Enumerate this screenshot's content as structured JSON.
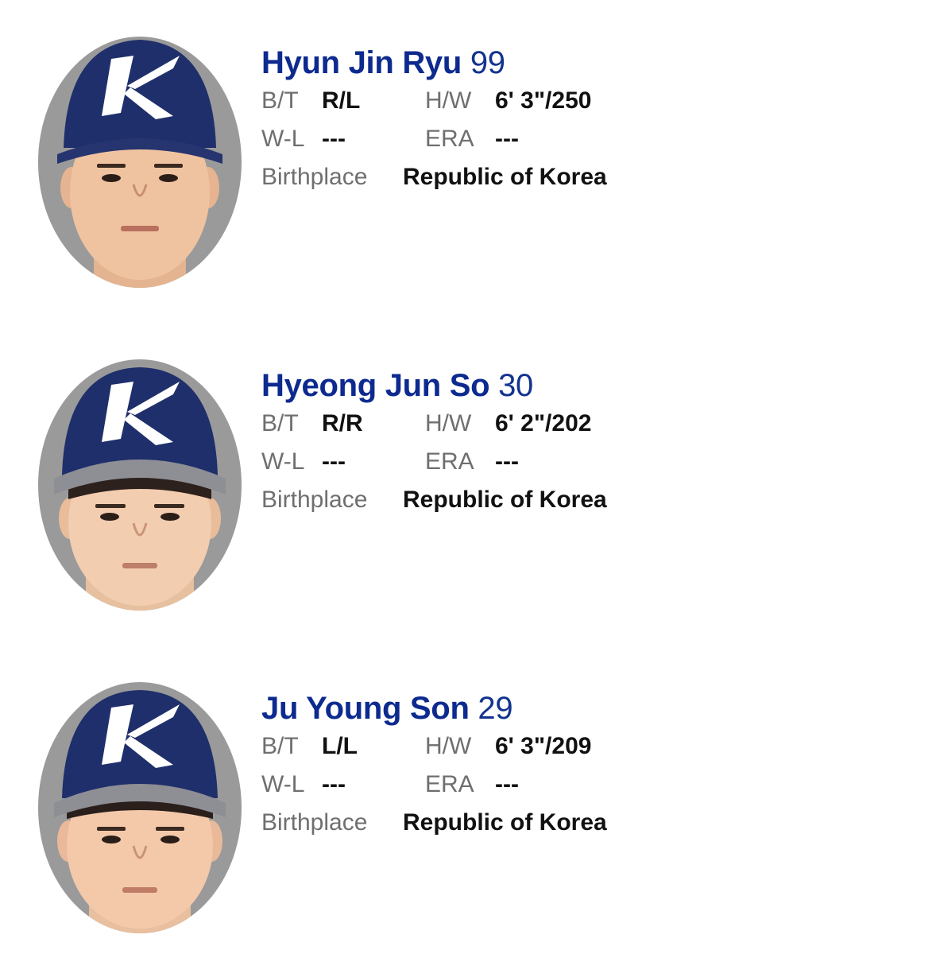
{
  "labels": {
    "bt": "B/T",
    "hw": "H/W",
    "wl": "W-L",
    "era": "ERA",
    "birthplace": "Birthplace"
  },
  "colors": {
    "name": "#0d2a8f",
    "label": "#6f6f6f",
    "value": "#111111",
    "cap": "#1f2f6b",
    "photo_bg": "#9a9a9a"
  },
  "players": [
    {
      "name": "Hyun Jin Ryu",
      "number": "99",
      "bt": "R/L",
      "hw": "6' 3\"/250",
      "wl": "---",
      "era": "---",
      "birthplace": "Republic of Korea",
      "photo_icon": "player-headshot-icon"
    },
    {
      "name": "Hyeong Jun So",
      "number": "30",
      "bt": "R/R",
      "hw": "6' 2\"/202",
      "wl": "---",
      "era": "---",
      "birthplace": "Republic of Korea",
      "photo_icon": "player-headshot-icon"
    },
    {
      "name": "Ju Young Son",
      "number": "29",
      "bt": "L/L",
      "hw": "6' 3\"/209",
      "wl": "---",
      "era": "---",
      "birthplace": "Republic of Korea",
      "photo_icon": "player-headshot-icon"
    }
  ]
}
